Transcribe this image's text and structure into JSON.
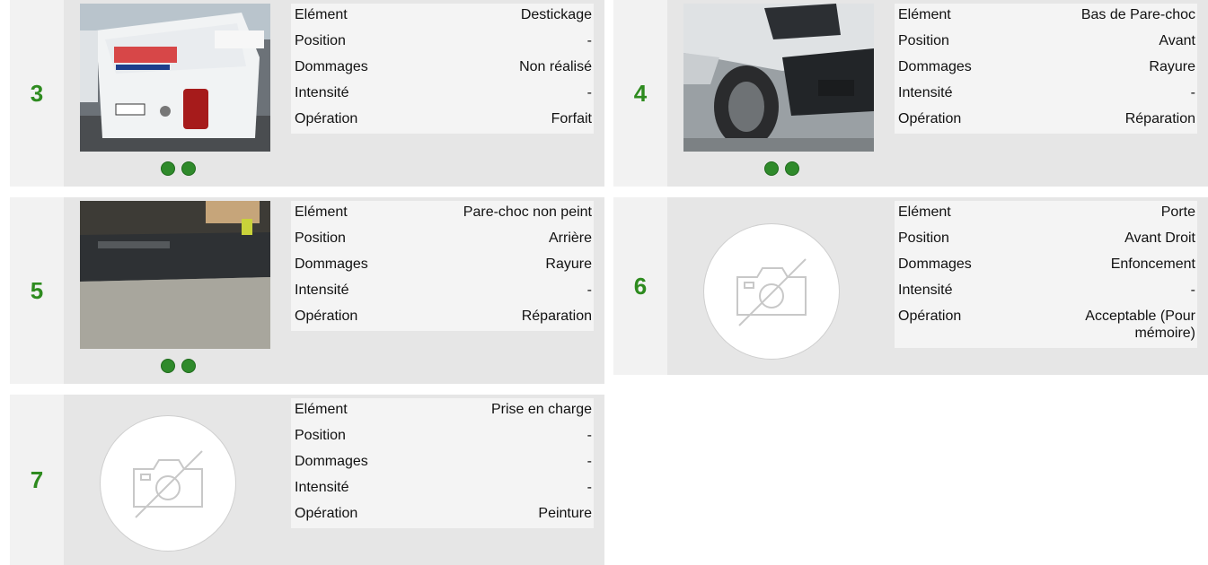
{
  "labels": {
    "element": "Elément",
    "position": "Position",
    "dommages": "Dommages",
    "intensite": "Intensité",
    "operation": "Opération"
  },
  "cards": [
    {
      "number": "3",
      "photo": "van-rear-photo",
      "dots": 2,
      "element": "Destickage",
      "position": "-",
      "dommages": "Non réalisé",
      "intensite": "-",
      "operation": "Forfait"
    },
    {
      "number": "4",
      "photo": "front-bumper-photo",
      "dots": 2,
      "element": "Bas de Pare-choc",
      "position": "Avant",
      "dommages": "Rayure",
      "intensite": "-",
      "operation": "Réparation"
    },
    {
      "number": "5",
      "photo": "rear-bumper-photo",
      "dots": 2,
      "element": "Pare-choc non peint",
      "position": "Arrière",
      "dommages": "Rayure",
      "intensite": "-",
      "operation": "Réparation"
    },
    {
      "number": "6",
      "photo": "no-photo",
      "dots": 0,
      "element": "Porte",
      "position": "Avant Droit",
      "dommages": "Enfoncement",
      "intensite": "-",
      "operation": "Acceptable (Pour mémoire)"
    },
    {
      "number": "7",
      "photo": "no-photo",
      "dots": 0,
      "element": "Prise en charge",
      "position": "-",
      "dommages": "-",
      "intensite": "-",
      "operation": "Peinture"
    }
  ],
  "colors": {
    "number": "#2e8b1f",
    "dot": "#2f8a2b",
    "card_bg": "#e6e6e6",
    "row_light": "#f4f4f4"
  }
}
